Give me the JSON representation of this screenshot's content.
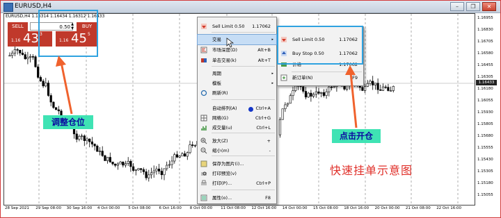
{
  "window": {
    "title": "EURUSD,H4",
    "buttons": {
      "minimize": "–",
      "restore": "❐",
      "close": "✕"
    }
  },
  "chart_header": {
    "symbol_info": "EURUSD,H4  1.16314 1.16434 1.16312 1.16433"
  },
  "one_click": {
    "sell_label": "SELL",
    "buy_label": "BUY",
    "lot": "0.50",
    "sell_price_prefix": "1.16",
    "sell_price_big": "43",
    "sell_price_sup": "3",
    "buy_price_prefix": "1.16",
    "buy_price_big": "45",
    "buy_price_sup": "5"
  },
  "annotations": {
    "adjust_position": "调整仓位",
    "click_open": "点击开仓",
    "quick_pending": "快速挂单示意图"
  },
  "yaxis": {
    "ticks": [
      "1.16955",
      "1.16830",
      "1.16705",
      "1.16580",
      "1.16455",
      "1.16305",
      "1.16180",
      "1.16055",
      "1.15930",
      "1.15805",
      "1.15680",
      "1.15555",
      "1.15430",
      "1.15305",
      "1.15180",
      "1.15055"
    ],
    "current": "1.16433"
  },
  "xaxis": {
    "ticks": [
      "28 Sep 2021",
      "29 Sep 08:00",
      "30 Sep 16:00",
      "4 Oct 00:00",
      "5 Oct 08:00",
      "6 Oct 16:00",
      "8 Oct 00:00",
      "11 Oct 08:00",
      "12 Oct 16:00",
      "14 Oct 00:00",
      "15 Oct 08:00",
      "18 Oct 16:00",
      "20 Oct 00:00",
      "21 Oct 08:00",
      "22 Oct 16:00"
    ]
  },
  "context_menu": [
    {
      "label": "Sell Limit 0.50",
      "extra": "1.17062",
      "icon": "sell-arrow-icon"
    },
    {
      "label": "交易",
      "arrow": "▸",
      "icon": ""
    },
    {
      "label": "市场深度(D)",
      "shortcut": "Alt+B",
      "icon": "depth-icon"
    },
    {
      "label": "单击交易(k)",
      "shortcut": "Alt+T",
      "icon": "one-click-icon"
    },
    {
      "label": "周期",
      "arrow": "▸",
      "icon": ""
    },
    {
      "label": "模板",
      "arrow": "▸",
      "icon": ""
    },
    {
      "label": "刷新(R)",
      "icon": "refresh-icon"
    },
    {
      "label": "自动排列(A)",
      "shortcut": "Ctrl+A",
      "icon": ""
    },
    {
      "label": "网格(G)",
      "shortcut": "Ctrl+G",
      "icon": "grid-icon"
    },
    {
      "label": "成交量(u)",
      "shortcut": "Ctrl+L",
      "icon": "volume-icon"
    },
    {
      "label": "放大(Z)",
      "shortcut": "+",
      "icon": "zoom-in-icon"
    },
    {
      "label": "缩小(m)",
      "shortcut": "-",
      "icon": "zoom-out-icon"
    },
    {
      "label": "保存为图片(i)...",
      "icon": "save-image-icon"
    },
    {
      "label": "打印预览(v)",
      "icon": "print-preview-icon"
    },
    {
      "label": "打印(P)...",
      "shortcut": "Ctrl+P",
      "icon": "print-icon"
    },
    {
      "label": "属性(o)...",
      "shortcut": "F8",
      "icon": "properties-icon"
    }
  ],
  "sub_menu": [
    {
      "label": "Sell Limit 0.50",
      "extra": "1.17062",
      "icon": "sell-arrow-icon"
    },
    {
      "label": "Buy Stop 0.50",
      "extra": "1.17062",
      "icon": "buy-arrow-icon"
    },
    {
      "label": "价格",
      "extra": "1.17062",
      "icon": "price-icon"
    },
    {
      "label": "新订单(N)",
      "shortcut": "F9",
      "icon": "new-order-icon"
    }
  ],
  "colors": {
    "bull": "#ffffff",
    "bear": "#000000",
    "menu_highlight": "#c6ddf5",
    "annotation_green": "#3fe3b4",
    "annotation_red": "#e0302a",
    "frame_blue": "#2ea2e0"
  }
}
